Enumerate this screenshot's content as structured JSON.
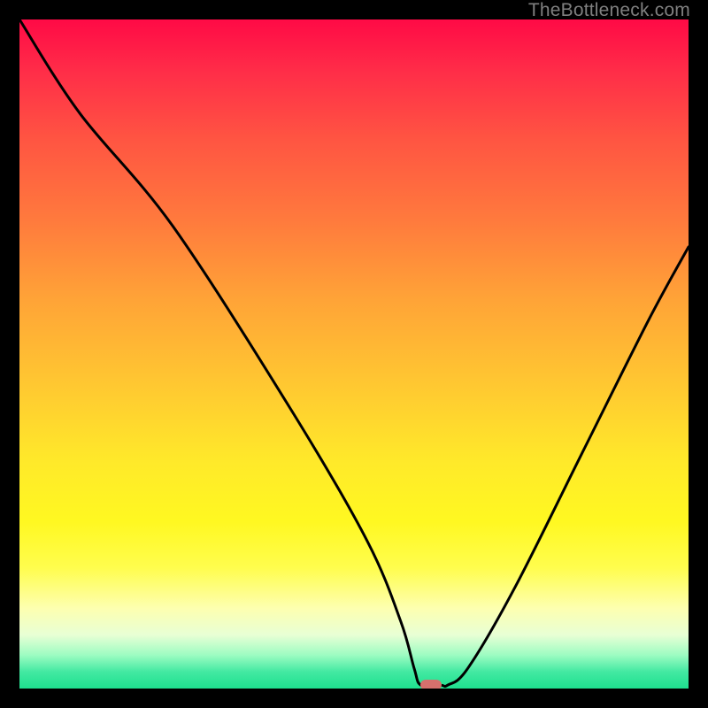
{
  "watermark": "TheBottleneck.com",
  "chart_data": {
    "type": "line",
    "title": "",
    "xlabel": "",
    "ylabel": "",
    "xlim": [
      0,
      100
    ],
    "ylim": [
      0,
      100
    ],
    "series": [
      {
        "name": "bottleneck-curve",
        "x": [
          0,
          9,
          23,
          41,
          52,
          57,
          59,
          60,
          63,
          64,
          67,
          74,
          84,
          94,
          100
        ],
        "values": [
          100,
          86,
          69,
          41,
          22,
          10,
          3,
          0.5,
          0.5,
          0.5,
          3,
          15,
          35,
          55,
          66
        ]
      }
    ],
    "marker": {
      "x": 61.5,
      "y": 0.5,
      "color": "#d6706d"
    },
    "gradient_stops": [
      {
        "pos": 0,
        "color": "#ff0a46"
      },
      {
        "pos": 0.08,
        "color": "#ff2e48"
      },
      {
        "pos": 0.18,
        "color": "#ff5542"
      },
      {
        "pos": 0.3,
        "color": "#ff7a3d"
      },
      {
        "pos": 0.42,
        "color": "#ffa437"
      },
      {
        "pos": 0.55,
        "color": "#ffc931"
      },
      {
        "pos": 0.66,
        "color": "#ffe92a"
      },
      {
        "pos": 0.75,
        "color": "#fff821"
      },
      {
        "pos": 0.82,
        "color": "#fffd4e"
      },
      {
        "pos": 0.88,
        "color": "#fdffb0"
      },
      {
        "pos": 0.92,
        "color": "#e8ffd5"
      },
      {
        "pos": 0.95,
        "color": "#9dfcc2"
      },
      {
        "pos": 0.975,
        "color": "#43e9a2"
      },
      {
        "pos": 1.0,
        "color": "#1ee08f"
      }
    ]
  }
}
